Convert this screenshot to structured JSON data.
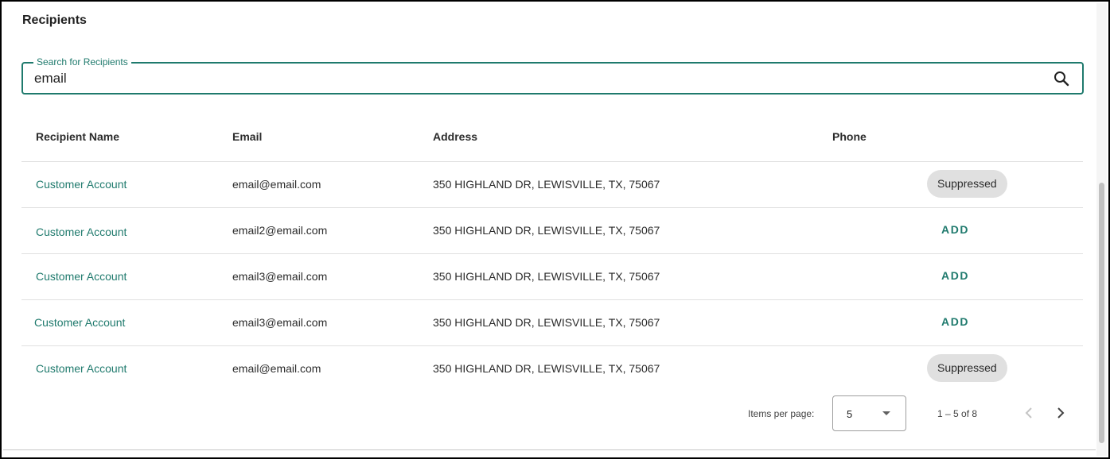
{
  "section": {
    "title": "Recipients"
  },
  "search": {
    "label": "Search for Recipients",
    "value": "email"
  },
  "table": {
    "columns": [
      "Recipient Name",
      "Email",
      "Address",
      "Phone"
    ],
    "rows": [
      {
        "name": "Customer Account",
        "email": "email@email.com",
        "address": "350 HIGHLAND DR, LEWISVILLE, TX, 75067",
        "status": "Suppressed"
      },
      {
        "name": "Customer Account",
        "email": "email2@email.com",
        "address": "350 HIGHLAND DR, LEWISVILLE, TX, 75067",
        "action": "ADD"
      },
      {
        "name": "Customer Account",
        "email": "email3@email.com",
        "address": "350 HIGHLAND DR, LEWISVILLE, TX, 75067",
        "action": "ADD"
      },
      {
        "name": "Customer Account",
        "email": "email3@email.com",
        "address": "350 HIGHLAND DR, LEWISVILLE, TX, 75067",
        "action": "ADD"
      },
      {
        "name": "Customer Account",
        "email": "email@email.com",
        "address": "350 HIGHLAND DR, LEWISVILLE, TX, 75067",
        "status": "Suppressed"
      }
    ]
  },
  "paginator": {
    "items_per_page_label": "Items per page:",
    "items_per_page_value": "5",
    "range_label": "1 – 5 of 8",
    "prev_enabled": false,
    "next_enabled": true
  },
  "colors": {
    "accent": "#1f7a6d",
    "chip_bg": "#e0e0e0",
    "disabled_icon": "#c4c4c4",
    "enabled_icon": "#424242"
  },
  "icons": {
    "search": "search-icon",
    "dropdown": "chevron-down-icon",
    "prev": "chevron-left-icon",
    "next": "chevron-right-icon"
  }
}
